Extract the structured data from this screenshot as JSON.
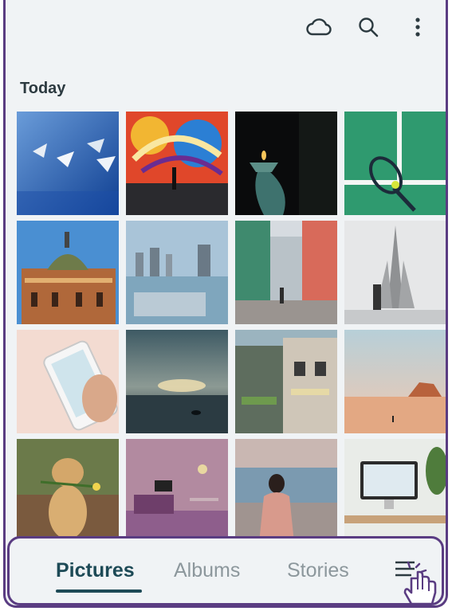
{
  "header": {
    "actions": [
      {
        "icon": "cloud-icon"
      },
      {
        "icon": "search-icon"
      },
      {
        "icon": "more-vertical-icon"
      }
    ]
  },
  "section": {
    "title": "Today"
  },
  "photos": [
    {
      "subject": "paper boats on blue"
    },
    {
      "subject": "graffiti wall"
    },
    {
      "subject": "candle holder"
    },
    {
      "subject": "tennis racket on court"
    },
    {
      "subject": "station building dome"
    },
    {
      "subject": "city waterfront"
    },
    {
      "subject": "colorful street"
    },
    {
      "subject": "church tower"
    },
    {
      "subject": "phone in hand"
    },
    {
      "subject": "sunset over sea"
    },
    {
      "subject": "old town houses"
    },
    {
      "subject": "desert landscape"
    },
    {
      "subject": "dog with flower"
    },
    {
      "subject": "purple living room"
    },
    {
      "subject": "woman by sea"
    },
    {
      "subject": "desk workspace"
    }
  ],
  "bottom_nav": {
    "tabs": [
      {
        "label": "Pictures",
        "active": true
      },
      {
        "label": "Albums",
        "active": false
      },
      {
        "label": "Stories",
        "active": false
      }
    ],
    "menu_icon": "menu-icon"
  },
  "colors": {
    "accent": "#1d4a56",
    "inactive": "#8c979c",
    "frame": "#5a3c82",
    "background": "#f0f3f5"
  }
}
